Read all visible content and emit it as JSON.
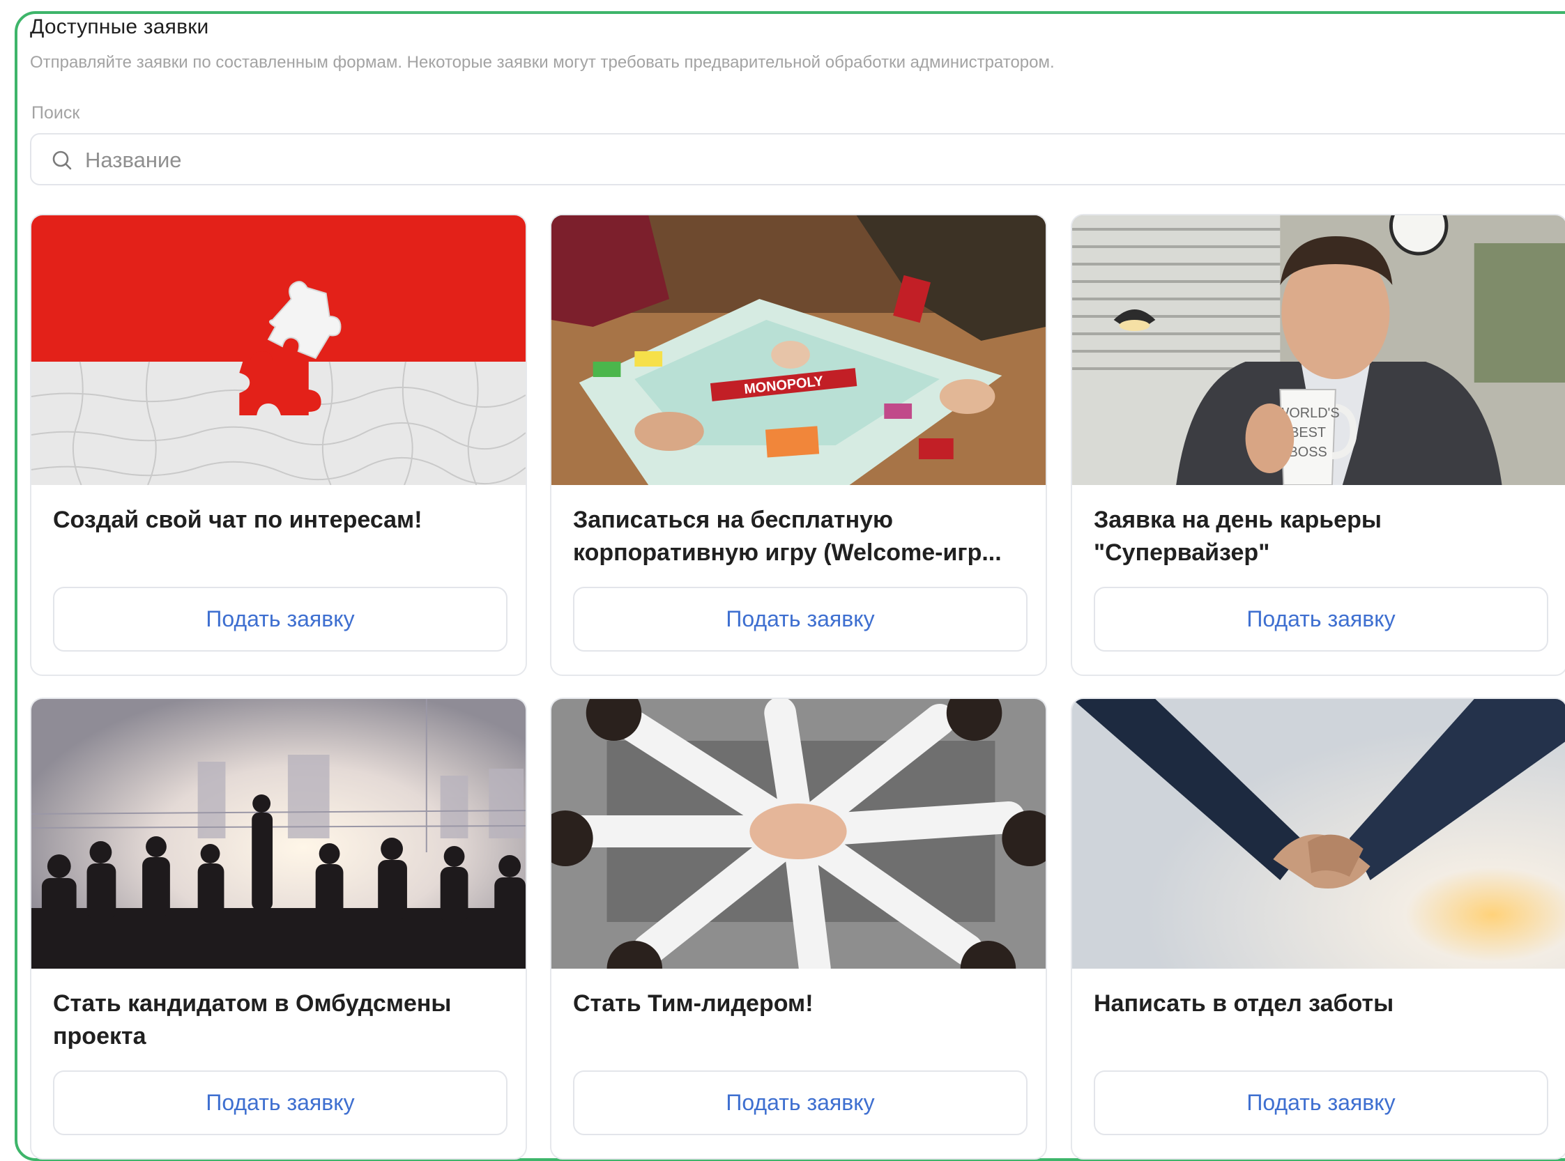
{
  "header": {
    "title": "Доступные заявки",
    "subtitle": "Отправляйте заявки по составленным формам. Некоторые заявки могут требовать предварительной обработки администратором."
  },
  "search": {
    "label": "Поиск",
    "placeholder": "Название",
    "value": ""
  },
  "cards": [
    {
      "title": "Создай свой чат по интересам!",
      "button": "Подать заявку",
      "image": "puzzle-image"
    },
    {
      "title_line1": "Записаться на бесплатную",
      "title_line2": "корпоративную игру (Welcome-игр...",
      "button": "Подать заявку",
      "image": "monopoly-image"
    },
    {
      "title_line1": "Заявка на день карьеры",
      "title_line2": "\"Супервайзер\"",
      "button": "Подать заявку",
      "image": "boss-mug-image",
      "mug_text": [
        "WORLD'S",
        "BEST",
        "BOSS"
      ]
    },
    {
      "title_line1": "Стать кандидатом в Омбудсмены",
      "title_line2": "проекта",
      "button": "Подать заявку",
      "image": "meeting-image"
    },
    {
      "title": "Стать Тим-лидером!",
      "button": "Подать заявку",
      "image": "team-hands-image"
    },
    {
      "title": "Написать в отдел заботы",
      "button": "Подать заявку",
      "image": "handshake-image"
    }
  ],
  "colors": {
    "frame_border": "#3eb56a",
    "button_text": "#3e6fd0",
    "puzzle_red": "#e32119"
  }
}
